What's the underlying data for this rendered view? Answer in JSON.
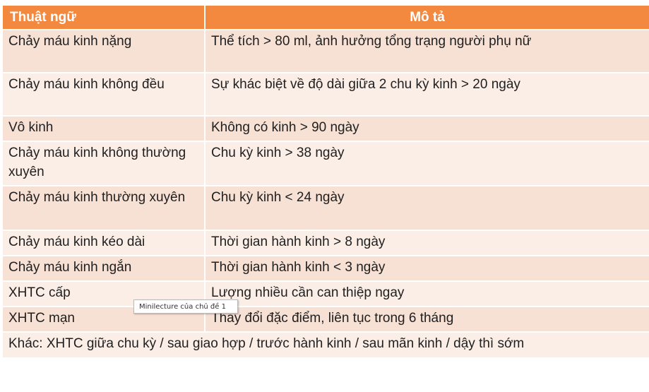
{
  "table": {
    "headers": [
      "Thuật ngữ",
      "Mô tả"
    ],
    "rows": [
      [
        "Chảy máu kinh nặng",
        "Thể tích > 80 ml, ảnh hưởng tổng trạng người phụ nữ"
      ],
      [
        "Chảy máu kinh không đều",
        "Sự khác biệt về độ dài giữa 2 chu kỳ kinh > 20 ngày"
      ],
      [
        "Vô kinh",
        "Không có kinh > 90 ngày"
      ],
      [
        "Chảy máu kinh không thường xuyên",
        "Chu kỳ kinh > 38 ngày"
      ],
      [
        "Chảy máu kinh thường xuyên",
        "Chu kỳ kinh < 24 ngày"
      ],
      [
        "Chảy máu kinh kéo dài",
        "Thời gian hành kinh > 8 ngày"
      ],
      [
        "Chảy máu kinh ngắn",
        "Thời gian hành kinh < 3 ngày"
      ],
      [
        "XHTC cấp",
        "Lượng nhiều cần can thiệp ngay"
      ],
      [
        "XHTC mạn",
        "Thay đổi đặc điểm, liên tục trong 6 tháng"
      ]
    ],
    "footer": "Khác: XHTC giữa chu kỳ / sau giao hợp / trước hành kinh / sau mãn kinh / dậy thì sớm"
  },
  "tooltip": {
    "text": "Minilecture của chủ đề 1"
  },
  "colors": {
    "header": "#f2893f",
    "row_dark": "#f7e0d4",
    "row_light": "#fbeee7"
  }
}
